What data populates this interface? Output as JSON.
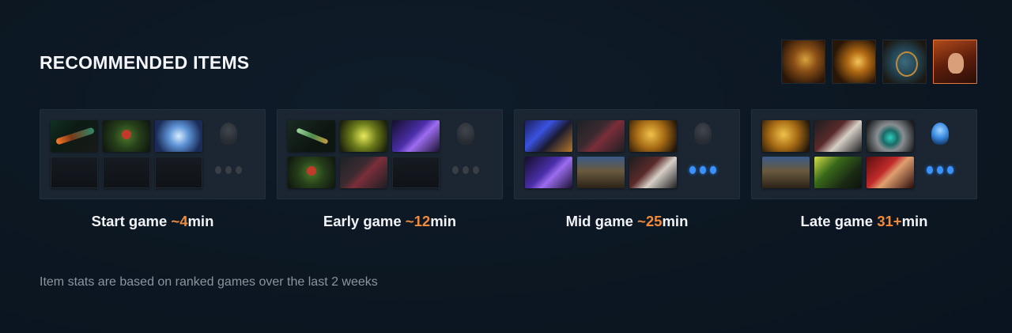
{
  "title": "RECOMMENDED ITEMS",
  "heroes": [
    {
      "icon": "hero-1-icon",
      "active": false
    },
    {
      "icon": "hero-2-icon",
      "active": false
    },
    {
      "icon": "hero-3-icon",
      "active": false
    },
    {
      "icon": "hero-4-icon",
      "active": true
    }
  ],
  "phases": [
    {
      "label_prefix": "Start game ",
      "time": "~4",
      "label_suffix": "min"
    },
    {
      "label_prefix": "Early game ",
      "time": "~12",
      "label_suffix": "min"
    },
    {
      "label_prefix": "Mid game ",
      "time": "~25",
      "label_suffix": "min"
    },
    {
      "label_prefix": "Late game ",
      "time": "31+",
      "label_suffix": "min"
    }
  ],
  "footnote": "Item stats are based on ranked games over the last 2 weeks",
  "colors": {
    "accent": "#f08a3c",
    "panel": "#1b2632",
    "background": "#0c1722"
  }
}
